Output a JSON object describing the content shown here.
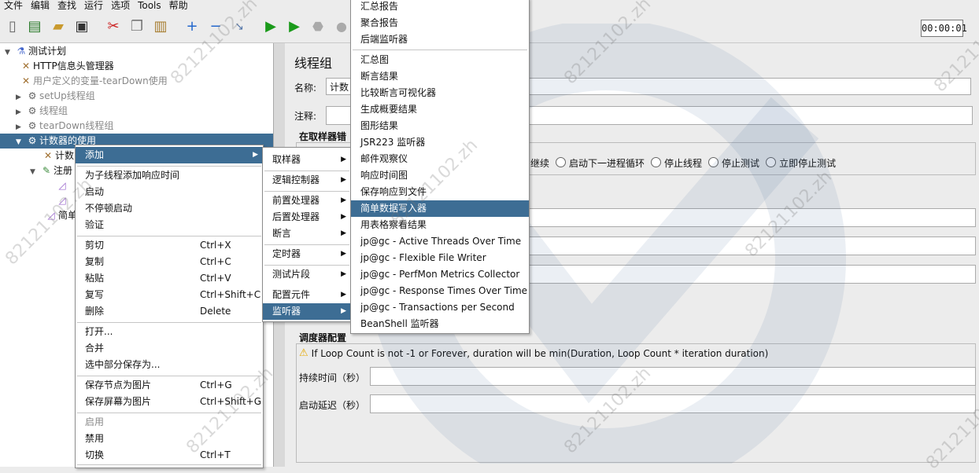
{
  "menubar": [
    "文件",
    "编辑",
    "查找",
    "运行",
    "选项",
    "Tools",
    "帮助"
  ],
  "timer": "00:00:01",
  "tree": {
    "items": [
      {
        "label": "测试计划",
        "icon": "flask-icon"
      },
      {
        "label": "HTTP信息头管理器",
        "icon": "wrench-icon"
      },
      {
        "label": "用户定义的变量-tearDown使用",
        "icon": "wrench-icon"
      },
      {
        "label": "setUp线程组",
        "icon": "gear-icon"
      },
      {
        "label": "线程组",
        "icon": "gear-icon"
      },
      {
        "label": "tearDown线程组",
        "icon": "gear-icon"
      },
      {
        "label": "计数器的使用",
        "icon": "gear-icon"
      },
      {
        "label": "计数",
        "icon": "wrench-icon"
      },
      {
        "label": "注册",
        "icon": "pen-icon"
      },
      {
        "label": "简单",
        "icon": "chart-icon"
      }
    ]
  },
  "panel": {
    "title": "线程组",
    "name_label": "名称:",
    "name_value": "计数",
    "comment_label": "注释:",
    "sampler_error_heading": "在取样器错",
    "radio_options": [
      "继续",
      "启动下一进程循环",
      "停止线程",
      "停止测试",
      "立即停止测试"
    ],
    "scheduler_heading": "调度器配置",
    "warning": "If Loop Count is not -1 or Forever, duration will be min(Duration, Loop Count * iteration duration)",
    "duration_label": "持续时间（秒）",
    "delay_label": "启动延迟（秒）"
  },
  "context_menu": {
    "items": [
      {
        "label": "添加",
        "shortcut": "",
        "submenu": true,
        "highlight": true
      },
      {
        "label": "为子线程添加响应时间",
        "shortcut": ""
      },
      {
        "label": "启动",
        "shortcut": ""
      },
      {
        "label": "不停顿启动",
        "shortcut": ""
      },
      {
        "label": "验证",
        "shortcut": ""
      },
      {
        "label": "剪切",
        "shortcut": "Ctrl+X"
      },
      {
        "label": "复制",
        "shortcut": "Ctrl+C"
      },
      {
        "label": "粘贴",
        "shortcut": "Ctrl+V"
      },
      {
        "label": "复写",
        "shortcut": "Ctrl+Shift+C"
      },
      {
        "label": "删除",
        "shortcut": "Delete"
      },
      {
        "label": "打开...",
        "shortcut": ""
      },
      {
        "label": "合并",
        "shortcut": ""
      },
      {
        "label": "选中部分保存为...",
        "shortcut": ""
      },
      {
        "label": "保存节点为图片",
        "shortcut": "Ctrl+G"
      },
      {
        "label": "保存屏幕为图片",
        "shortcut": "Ctrl+Shift+G"
      },
      {
        "label": "启用",
        "shortcut": "",
        "disabled": true
      },
      {
        "label": "禁用",
        "shortcut": ""
      },
      {
        "label": "切换",
        "shortcut": "Ctrl+T"
      }
    ]
  },
  "add_submenu": {
    "items": [
      {
        "label": "取样器"
      },
      {
        "label": "逻辑控制器"
      },
      {
        "label": "前置处理器"
      },
      {
        "label": "后置处理器"
      },
      {
        "label": "断言"
      },
      {
        "label": "定时器"
      },
      {
        "label": "测试片段"
      },
      {
        "label": "配置元件"
      },
      {
        "label": "监听器",
        "highlight": true
      }
    ]
  },
  "listener_submenu": {
    "items": [
      {
        "label": "汇总报告"
      },
      {
        "label": "聚合报告"
      },
      {
        "label": "后端监听器"
      },
      {
        "label": "汇总图"
      },
      {
        "label": "断言结果"
      },
      {
        "label": "比较断言可视化器"
      },
      {
        "label": "生成概要结果"
      },
      {
        "label": "图形结果"
      },
      {
        "label": "JSR223 监听器"
      },
      {
        "label": "邮件观察仪"
      },
      {
        "label": "响应时间图"
      },
      {
        "label": "保存响应到文件"
      },
      {
        "label": "简单数据写入器",
        "highlight": true
      },
      {
        "label": "用表格察看结果"
      },
      {
        "label": "jp@gc - Active Threads Over Time"
      },
      {
        "label": "jp@gc - Flexible File Writer"
      },
      {
        "label": "jp@gc - PerfMon Metrics Collector"
      },
      {
        "label": "jp@gc - Response Times Over Time"
      },
      {
        "label": "jp@gc - Transactions per Second"
      },
      {
        "label": "BeanShell 监听器"
      }
    ]
  },
  "watermark": "82121102.zh",
  "colors": {
    "selection": "#3d6d94",
    "menu_bg": "#ffffff",
    "window_bg": "#ececec"
  }
}
